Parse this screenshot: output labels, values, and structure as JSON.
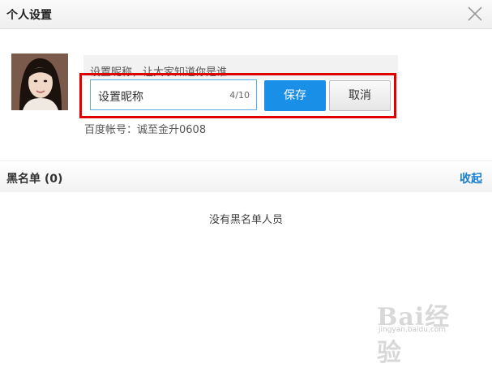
{
  "dialog": {
    "title": "个人设置"
  },
  "icons": {
    "close": "close-icon",
    "avatar": "avatar-image"
  },
  "profile": {
    "nickname_hint": "设置昵称，让大家知道你是谁",
    "nickname_value": "设置昵称",
    "nickname_count": "4/10",
    "save_label": "保存",
    "cancel_label": "取消",
    "account_label": "百度帐号：诚至金升0608"
  },
  "blacklist": {
    "title": "黑名单 (0)",
    "collapse_label": "收起",
    "empty_text": "没有黑名单人员"
  },
  "watermark": {
    "brand": "Bai经验",
    "url": "jingyan.baidu.com"
  },
  "colors": {
    "primary": "#1a8fe8",
    "highlight_frame": "#e00000",
    "link": "#1a7fd0"
  }
}
